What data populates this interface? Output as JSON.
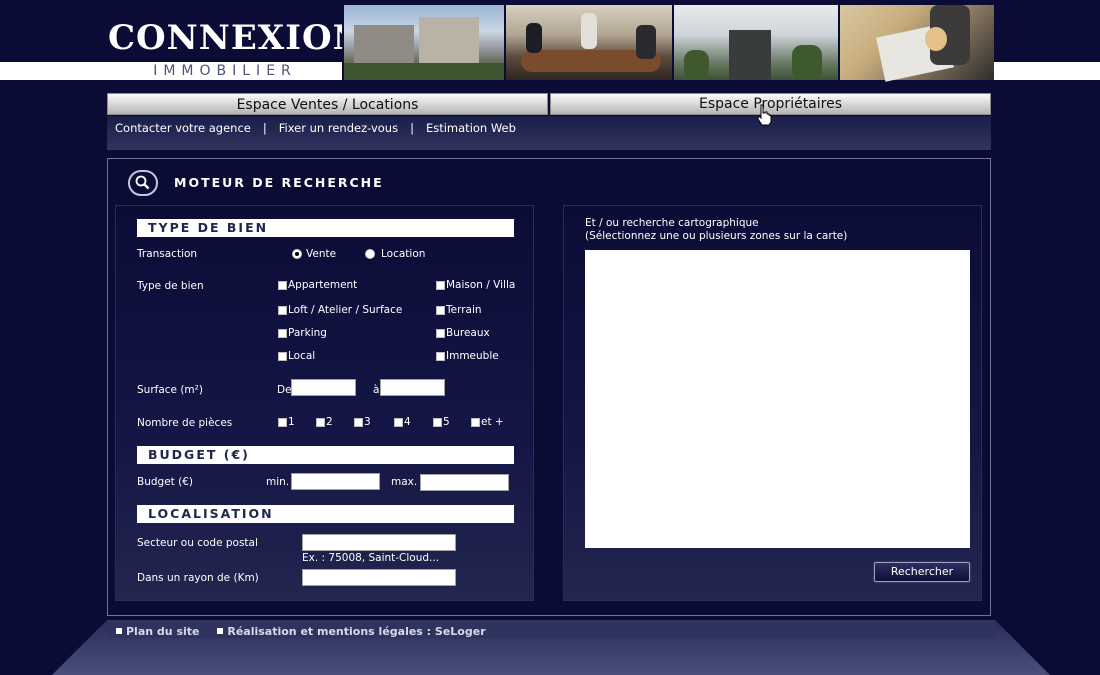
{
  "logo": {
    "main": "CONNEXION",
    "sub": "IMMOBILIER"
  },
  "nav": {
    "tabs": [
      "Espace Ventes / Locations",
      "Espace Propriétaires"
    ],
    "subnav": [
      "Contacter votre agence",
      "Fixer un rendez-vous",
      "Estimation Web"
    ],
    "separator": "|"
  },
  "search": {
    "title": "MOTEUR DE RECHERCHE",
    "type_de_bien_header": "TYPE DE BIEN",
    "transaction_label": "Transaction",
    "transaction_options": [
      "Vente",
      "Location"
    ],
    "transaction_selected": "Vente",
    "type_label": "Type de bien",
    "types": [
      "Appartement",
      "Maison / Villa",
      "Loft / Atelier / Surface",
      "Terrain",
      "Parking",
      "Bureaux",
      "Local",
      "Immeuble"
    ],
    "surface_label": "Surface (m²)",
    "surface_from": "De",
    "surface_to": "à",
    "surface_from_value": "",
    "surface_to_value": "",
    "rooms_label": "Nombre de pièces",
    "rooms": [
      "1",
      "2",
      "3",
      "4",
      "5",
      "et +"
    ],
    "budget_header": "BUDGET (€)",
    "budget_label": "Budget (€)",
    "budget_min": "min.",
    "budget_max": "max.",
    "budget_min_value": "",
    "budget_max_value": "",
    "localisation_header": "LOCALISATION",
    "secteur_label": "Secteur ou code postal",
    "secteur_value": "",
    "secteur_hint": "Ex. : 75008, Saint-Cloud...",
    "rayon_label": "Dans un rayon de (Km)",
    "rayon_value": ""
  },
  "map": {
    "line1": "Et / ou recherche cartographique",
    "line2": "(Sélectionnez une ou plusieurs zones sur la carte)"
  },
  "search_button": "Rechercher",
  "footer": {
    "links": [
      "Plan du site",
      "Réalisation et mentions légales : SeLoger"
    ]
  },
  "colors": {
    "background": "#0b0c36",
    "section_header_text": "#22264e",
    "nav_tab": "#d8d8d8"
  }
}
